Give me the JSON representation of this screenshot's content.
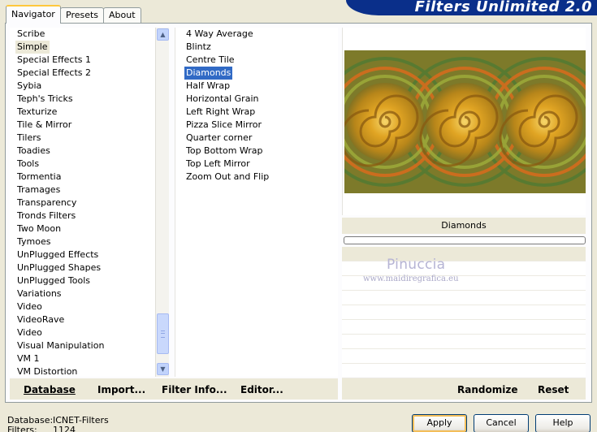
{
  "app": {
    "title": "Filters Unlimited 2.0"
  },
  "tabs": [
    {
      "label": "Navigator",
      "active": true
    },
    {
      "label": "Presets",
      "active": false
    },
    {
      "label": "About",
      "active": false
    }
  ],
  "categories": {
    "items": [
      "Scribe",
      "Simple",
      "Special Effects 1",
      "Special Effects 2",
      "Sybia",
      "Teph's Tricks",
      "Texturize",
      "Tile & Mirror",
      "Tilers",
      "Toadies",
      "Tools",
      "Tormentia",
      "Tramages",
      "Transparency",
      "Tronds Filters",
      "Two Moon",
      "Tymoes",
      "UnPlugged Effects",
      "UnPlugged Shapes",
      "UnPlugged Tools",
      "Variations",
      "Video",
      "VideoRave",
      "Video",
      "Visual Manipulation",
      "VM 1",
      "VM Distortion"
    ],
    "selected": "Simple"
  },
  "filters": {
    "items": [
      "4 Way Average",
      "Blintz",
      "Centre Tile",
      "Diamonds",
      "Half Wrap",
      "Horizontal Grain",
      "Left Right Wrap",
      "Pizza Slice Mirror",
      "Quarter corner",
      "Top Bottom Wrap",
      "Top Left Mirror",
      "Zoom Out and Flip"
    ],
    "selected": "Diamonds"
  },
  "preview": {
    "filter_name": "Diamonds",
    "watermark_name": "Pinuccia",
    "watermark_url": "www.maidiregrafica.eu"
  },
  "buttons": {
    "database": "Database",
    "import": "Import...",
    "filter_info": "Filter Info...",
    "editor": "Editor...",
    "randomize": "Randomize",
    "reset": "Reset",
    "apply": "Apply",
    "cancel": "Cancel",
    "help": "Help"
  },
  "status": {
    "database_label": "Database:",
    "database_value": "ICNET-Filters",
    "filters_label": "Filters:",
    "filters_value": "1124"
  },
  "colors": {
    "brand": "#0a2f8a",
    "selection": "#316ac5",
    "background": "#ece9d8"
  }
}
